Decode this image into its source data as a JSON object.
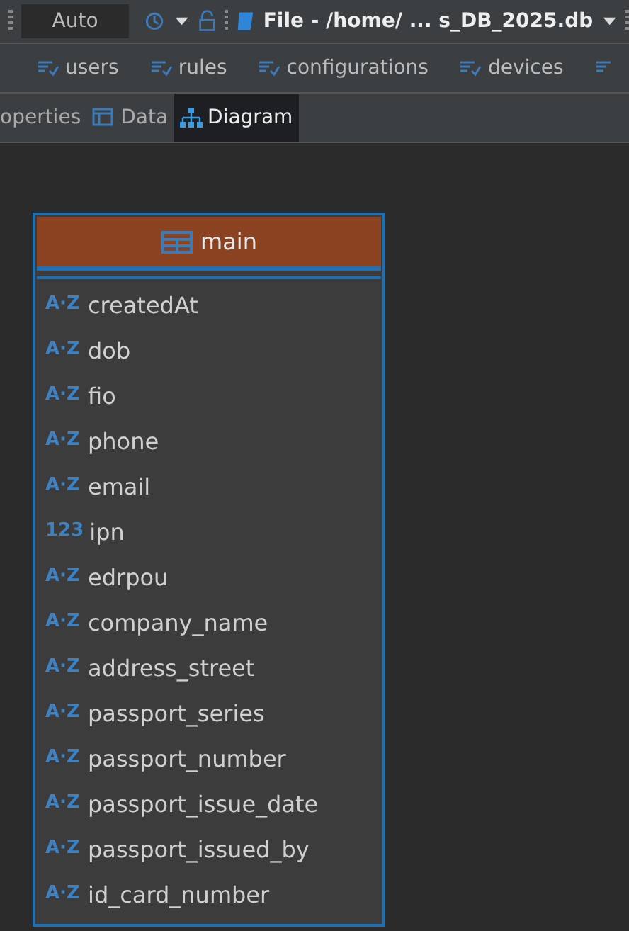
{
  "toolbar": {
    "mode": "Auto",
    "file": "File - /home/ ... s_DB_2025.db"
  },
  "object_tabs": [
    {
      "label": "users"
    },
    {
      "label": "rules"
    },
    {
      "label": "configurations"
    },
    {
      "label": "devices"
    }
  ],
  "view_tabs": [
    {
      "label": "operties",
      "kind": "properties",
      "selected": false
    },
    {
      "label": "Data",
      "kind": "data",
      "selected": false
    },
    {
      "label": "Diagram",
      "kind": "diagram",
      "selected": true
    }
  ],
  "entity": {
    "name": "main",
    "columns": [
      {
        "name": "createdAt",
        "type_glyph": "A·Z"
      },
      {
        "name": "dob",
        "type_glyph": "A·Z"
      },
      {
        "name": "fio",
        "type_glyph": "A·Z"
      },
      {
        "name": "phone",
        "type_glyph": "A·Z"
      },
      {
        "name": "email",
        "type_glyph": "A·Z"
      },
      {
        "name": "ipn",
        "type_glyph": "123"
      },
      {
        "name": "edrpou",
        "type_glyph": "A·Z"
      },
      {
        "name": "company_name",
        "type_glyph": "A·Z"
      },
      {
        "name": "address_street",
        "type_glyph": "A·Z"
      },
      {
        "name": "passport_series",
        "type_glyph": "A·Z"
      },
      {
        "name": "passport_number",
        "type_glyph": "A·Z"
      },
      {
        "name": "passport_issue_date",
        "type_glyph": "A·Z"
      },
      {
        "name": "passport_issued_by",
        "type_glyph": "A·Z"
      },
      {
        "name": "id_card_number",
        "type_glyph": "A·Z"
      }
    ]
  }
}
